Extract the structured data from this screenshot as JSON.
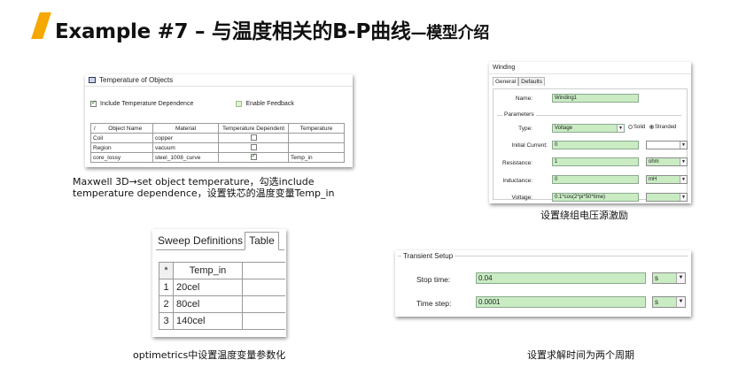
{
  "title": {
    "main": "Example #7 – 与温度相关的B-P曲线",
    "suffix": "—模型介绍"
  },
  "temperature_dialog": {
    "window_title": "Temperature of Objects",
    "include_label": "Include Temperature Dependence",
    "enable_feedback_label": "Enable Feedback",
    "columns": [
      "/",
      "Object Name",
      "Material",
      "Temperature Dependent",
      "Temperature"
    ],
    "rows": [
      {
        "name": "Coil",
        "material": "copper",
        "temperature": ""
      },
      {
        "name": "Region",
        "material": "vacuum",
        "temperature": ""
      },
      {
        "name": "core_lossy",
        "material": "steel_1008_curve",
        "temperature": "Temp_in"
      }
    ]
  },
  "caption_temperature": {
    "line1": "Maxwell 3D→set object temperature，勾选include",
    "line2": "temperature dependence，设置铁芯的温度变量Temp_in"
  },
  "winding_dialog": {
    "window_title": "Winding",
    "tabs": [
      "General",
      "Defaults"
    ],
    "name_label": "Name:",
    "name_value": "Winding1",
    "parameters_legend": "Parameters",
    "type_label": "Type:",
    "type_value": "Voltage",
    "solid_label": "Solid",
    "stranded_label": "Stranded",
    "initial_current_label": "Initial Current:",
    "initial_current_value": "0",
    "resistance_label": "Resistance:",
    "resistance_value": "1",
    "resistance_unit": "ohm",
    "inductance_label": "Inductance:",
    "inductance_value": "0",
    "inductance_unit": "mH",
    "voltage_label": "Voltage:",
    "voltage_value": "0.1*cos(2*pi*50*time)"
  },
  "caption_winding": "设置绕组电压源激励",
  "sweep_dialog": {
    "tabs": [
      "Sweep Definitions",
      "Table"
    ],
    "header_star": "*",
    "header_col": "Temp_in",
    "rows": [
      {
        "index": "1",
        "value": "20cel"
      },
      {
        "index": "2",
        "value": "80cel"
      },
      {
        "index": "3",
        "value": "140cel"
      }
    ]
  },
  "caption_sweep": "optimetrics中设置温度变量参数化",
  "transient_dialog": {
    "legend": "Transient Setup",
    "stop_time_label": "Stop time:",
    "stop_time_value": "0.04",
    "stop_time_unit": "s",
    "time_step_label": "Time step:",
    "time_step_value": "0.0001",
    "time_step_unit": "s"
  },
  "caption_transient": "设置求解时间为两个周期",
  "colors": {
    "accent_bar": "#f5a800",
    "field_green": "#c9ecc3"
  }
}
